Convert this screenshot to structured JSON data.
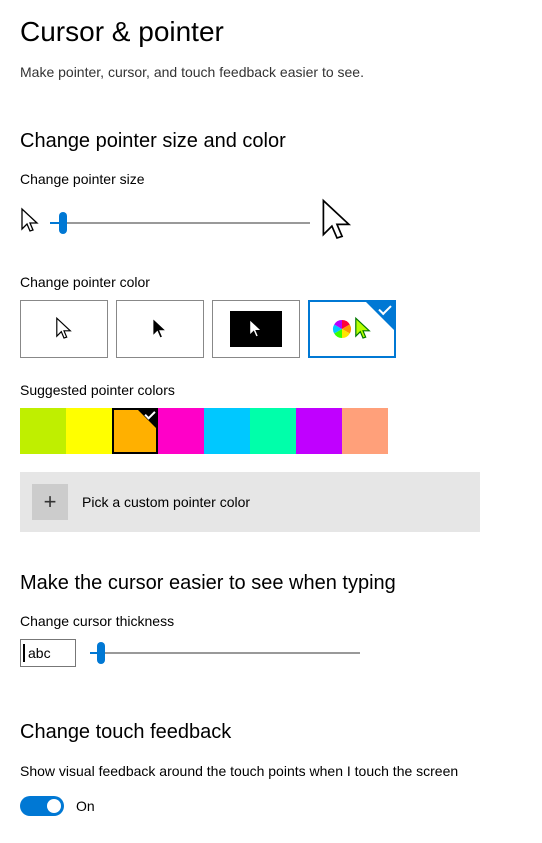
{
  "page": {
    "title": "Cursor & pointer",
    "subtitle": "Make pointer, cursor, and touch feedback easier to see."
  },
  "pointerSize": {
    "section_title": "Change pointer size and color",
    "label": "Change pointer size",
    "value_percent": 5
  },
  "pointerColor": {
    "label": "Change pointer color",
    "options": [
      {
        "id": "white",
        "selected": false
      },
      {
        "id": "black",
        "selected": false
      },
      {
        "id": "inverted",
        "selected": false
      },
      {
        "id": "custom-color",
        "selected": true
      }
    ]
  },
  "suggestedColors": {
    "label": "Suggested pointer colors",
    "swatches": [
      {
        "hex": "#bfef00",
        "selected": false
      },
      {
        "hex": "#ffff00",
        "selected": false
      },
      {
        "hex": "#ffb000",
        "selected": true
      },
      {
        "hex": "#ff00c8",
        "selected": false
      },
      {
        "hex": "#00c8ff",
        "selected": false
      },
      {
        "hex": "#00ffaa",
        "selected": false
      },
      {
        "hex": "#c000ff",
        "selected": false
      },
      {
        "hex": "#ffa07a",
        "selected": false
      }
    ],
    "custom_label": "Pick a custom pointer color"
  },
  "cursorThickness": {
    "section_title": "Make the cursor easier to see when typing",
    "label": "Change cursor thickness",
    "preview_text": "abc",
    "value_percent": 4
  },
  "touchFeedback": {
    "section_title": "Change touch feedback",
    "label": "Show visual feedback around the touch points when I touch the screen",
    "toggle_on": true,
    "toggle_text": "On"
  }
}
